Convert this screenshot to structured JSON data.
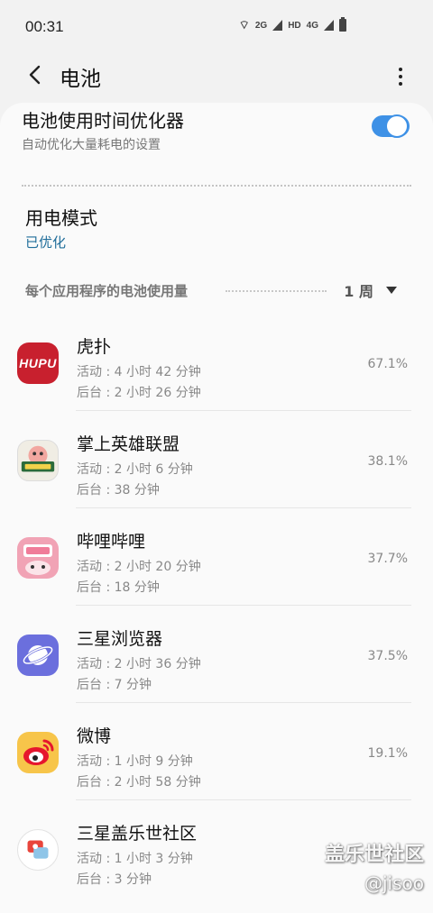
{
  "status_bar": {
    "time": "00:31",
    "net_labels": [
      "2G",
      "HD",
      "4G"
    ]
  },
  "header": {
    "title": "电池"
  },
  "optimizer": {
    "title": "电池使用时间优化器",
    "subtitle": "自动优化大量耗电的设置",
    "enabled": true
  },
  "power_mode": {
    "title": "用电模式",
    "value": "已优化"
  },
  "usage_section": {
    "title": "每个应用程序的电池使用量",
    "period": "1 周"
  },
  "apps": [
    {
      "name": "虎扑",
      "active": "活动 : 4 小时 42 分钟",
      "background": "后台 : 2 小时 26 分钟",
      "percent": "67.1%",
      "icon": "hupu-icon",
      "icon_text": "HUPU"
    },
    {
      "name": "掌上英雄联盟",
      "active": "活动 : 2 小时 6 分钟",
      "background": "后台 : 38 分钟",
      "percent": "38.1%",
      "icon": "lol-icon"
    },
    {
      "name": "哔哩哔哩",
      "active": "活动 : 2 小时 20 分钟",
      "background": "后台 : 18 分钟",
      "percent": "37.7%",
      "icon": "bilibili-icon"
    },
    {
      "name": "三星浏览器",
      "active": "活动 : 2 小时 36 分钟",
      "background": "后台 : 7 分钟",
      "percent": "37.5%",
      "icon": "browser-icon"
    },
    {
      "name": "微博",
      "active": "活动 : 1 小时 9 分钟",
      "background": "后台 : 2 小时 58 分钟",
      "percent": "19.1%",
      "icon": "weibo-icon"
    },
    {
      "name": "三星盖乐世社区",
      "active": "活动 : 1 小时 3 分钟",
      "background": "后台 : 3 分钟",
      "percent": "",
      "icon": "samsung-members-icon"
    }
  ],
  "watermark": {
    "title": "盖乐世社区",
    "handle": "@jisoo"
  },
  "colors": {
    "accent": "#3e91e6",
    "mode_value": "#1f6d9a"
  }
}
